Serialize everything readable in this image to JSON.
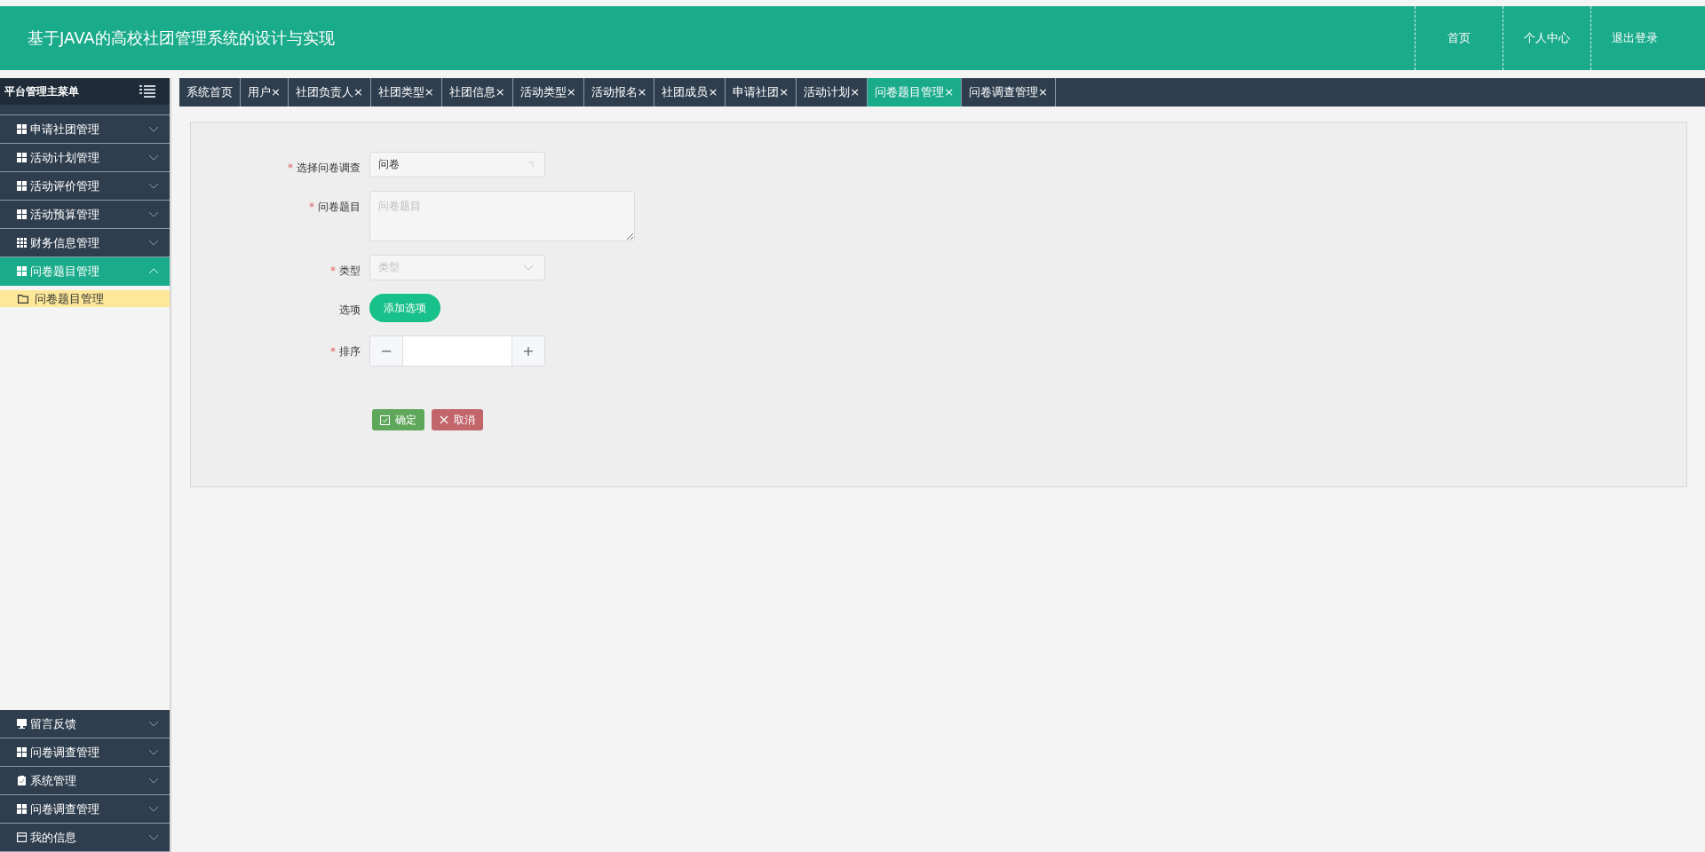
{
  "header": {
    "title": "基于JAVA的高校社团管理系统的设计与实现",
    "nav": [
      "首页",
      "个人中心",
      "退出登录"
    ]
  },
  "sidebar": {
    "title": "平台管理主菜单",
    "upper_items": [
      {
        "label": "申请社团管理",
        "kind": "grid",
        "expanded": false,
        "selected": false
      },
      {
        "label": "活动计划管理",
        "kind": "grid",
        "expanded": false,
        "selected": false
      },
      {
        "label": "活动评价管理",
        "kind": "grid",
        "expanded": false,
        "selected": false
      },
      {
        "label": "活动预算管理",
        "kind": "grid",
        "expanded": false,
        "selected": false
      },
      {
        "label": "财务信息管理",
        "kind": "table",
        "expanded": false,
        "selected": false
      },
      {
        "label": "问卷题目管理",
        "kind": "grid",
        "expanded": true,
        "selected": true,
        "children": [
          {
            "label": "问卷题目管理",
            "selected": true
          }
        ]
      }
    ],
    "lower_items": [
      {
        "label": "留言反馈",
        "kind": "monitor",
        "expanded": false,
        "selected": false
      },
      {
        "label": "问卷调查管理",
        "kind": "grid",
        "expanded": false,
        "selected": false
      },
      {
        "label": "系统管理",
        "kind": "clipboard",
        "expanded": false,
        "selected": false
      },
      {
        "label": "问卷调查管理",
        "kind": "grid",
        "expanded": false,
        "selected": false
      },
      {
        "label": "我的信息",
        "kind": "card",
        "expanded": false,
        "selected": false
      }
    ]
  },
  "tabs": [
    {
      "label": "系统首页",
      "selected": false
    },
    {
      "label": "用户×",
      "selected": false
    },
    {
      "label": "社团负责人×",
      "selected": false
    },
    {
      "label": "社团类型×",
      "selected": false
    },
    {
      "label": "社团信息×",
      "selected": false
    },
    {
      "label": "活动类型×",
      "selected": false
    },
    {
      "label": "活动报名×",
      "selected": false
    },
    {
      "label": "社团成员×",
      "selected": false
    },
    {
      "label": "申请社团×",
      "selected": false
    },
    {
      "label": "活动计划×",
      "selected": false
    },
    {
      "label": "问卷题目管理×",
      "selected": true
    },
    {
      "label": "问卷调查管理×",
      "selected": false
    }
  ],
  "form": {
    "fields": [
      {
        "label": "选择问卷调查",
        "required_mark": "*",
        "kind": "select",
        "value": "问卷"
      },
      {
        "label": "问卷题目",
        "required_mark": "*",
        "kind": "textarea",
        "placeholder": "问卷题目"
      },
      {
        "label": "类型",
        "required_mark": "*",
        "kind": "dropdown",
        "placeholder": "类型"
      },
      {
        "label": "选项",
        "kind": "add",
        "button": "添加选项"
      },
      {
        "label": "排序",
        "required_mark": "*",
        "kind": "number",
        "minus": "−",
        "plus": "+"
      }
    ],
    "buttons": [
      {
        "label": "确定",
        "kind": "confirm"
      },
      {
        "label": "取消",
        "kind": "cancel"
      }
    ]
  }
}
